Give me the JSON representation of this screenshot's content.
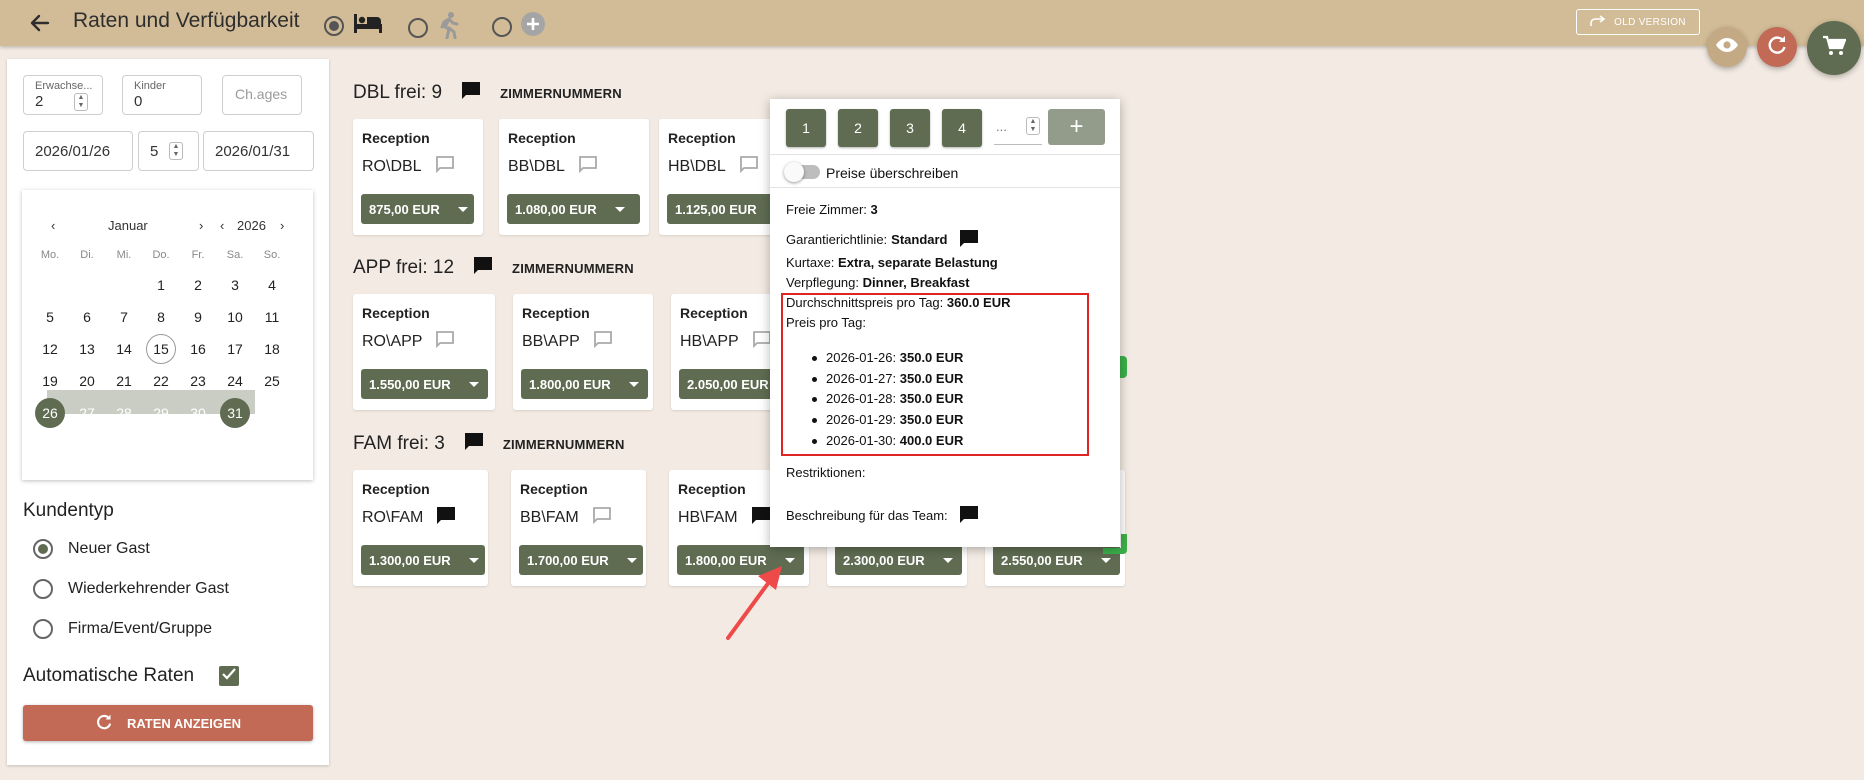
{
  "header": {
    "title": "Raten und Verfügbarkeit",
    "old_version_label": "OLD VERSION"
  },
  "guests": {
    "adults_label": "Erwachse...",
    "adults_value": "2",
    "children_label": "Kinder",
    "children_value": "0",
    "child_ages_placeholder": "Ch.ages"
  },
  "dates": {
    "arrival": "2026/01/26",
    "nights": "5",
    "departure": "2026/01/31"
  },
  "calendar": {
    "month": "Januar",
    "year": "2026",
    "weekdays": [
      "Mo.",
      "Di.",
      "Mi.",
      "Do.",
      "Fr.",
      "Sa.",
      "So."
    ],
    "days": [
      "1",
      "2",
      "3",
      "4",
      "5",
      "6",
      "7",
      "8",
      "9",
      "10",
      "11",
      "12",
      "13",
      "14",
      "15",
      "16",
      "17",
      "18",
      "19",
      "20",
      "21",
      "22",
      "23",
      "24",
      "25",
      "26",
      "27",
      "28",
      "29",
      "30",
      "31"
    ],
    "today": "15",
    "range_start": "26",
    "range_end": "31"
  },
  "customer_type": {
    "title": "Kundentyp",
    "options": [
      "Neuer Gast",
      "Wiederkehrender Gast",
      "Firma/Event/Gruppe"
    ],
    "selected": "Neuer Gast"
  },
  "auto_rates": {
    "label": "Automatische Raten",
    "checked": true
  },
  "show_rates_button": "RATEN ANZEIGEN",
  "room_numbers_label": "ZIMMERNUMMERN",
  "sections": [
    {
      "title": "DBL frei: 9",
      "cards": [
        {
          "label": "Reception",
          "code": "RO\\DBL",
          "price": "875,00 EUR"
        },
        {
          "label": "Reception",
          "code": "BB\\DBL",
          "price": "1.080,00 EUR"
        },
        {
          "label": "Reception",
          "code": "HB\\DBL",
          "price": "1.125,00 EUR"
        }
      ]
    },
    {
      "title": "APP frei: 12",
      "cards": [
        {
          "label": "Reception",
          "code": "RO\\APP",
          "price": "1.550,00 EUR"
        },
        {
          "label": "Reception",
          "code": "BB\\APP",
          "price": "1.800,00 EUR"
        },
        {
          "label": "Reception",
          "code": "HB\\APP",
          "price": "2.050,00 EUR"
        }
      ]
    },
    {
      "title": "FAM frei: 3",
      "cards": [
        {
          "label": "Reception",
          "code": "RO\\FAM",
          "price": "1.300,00 EUR"
        },
        {
          "label": "Reception",
          "code": "BB\\FAM",
          "price": "1.700,00 EUR"
        },
        {
          "label": "Reception",
          "code": "HB\\FAM",
          "price": "1.800,00 EUR"
        },
        {
          "label": "",
          "code": "",
          "price": "2.300,00 EUR"
        },
        {
          "label": "",
          "code": "",
          "price": "2.550,00 EUR"
        }
      ]
    }
  ],
  "popup": {
    "room_buttons": [
      "1",
      "2",
      "3",
      "4"
    ],
    "more_placeholder": "...",
    "override_label": "Preise überschreiben",
    "free_rooms_label": "Freie Zimmer:",
    "free_rooms_value": "3",
    "guarantee_label": "Garantierichtlinie:",
    "guarantee_value": "Standard",
    "tax_label": "Kurtaxe:",
    "tax_value": "Extra, separate Belastung",
    "meals_label": "Verpflegung:",
    "meals_value": "Dinner, Breakfast",
    "avg_label": "Durchschnittspreis pro Tag:",
    "avg_value": "360.0 EUR",
    "per_day_label": "Preis pro Tag:",
    "per_day": [
      {
        "date": "2026-01-26:",
        "price": "350.0 EUR"
      },
      {
        "date": "2026-01-27:",
        "price": "350.0 EUR"
      },
      {
        "date": "2026-01-28:",
        "price": "350.0 EUR"
      },
      {
        "date": "2026-01-29:",
        "price": "350.0 EUR"
      },
      {
        "date": "2026-01-30:",
        "price": "400.0 EUR"
      }
    ],
    "restrictions_label": "Restriktionen:",
    "team_desc_label": "Beschreibung für das Team:"
  },
  "colors": {
    "topbar": "#d2bc97",
    "accent_green": "#5f6c52",
    "accent_red": "#c26a55",
    "highlight": "#e02424"
  },
  "icons": [
    "back-arrow-icon",
    "bed-icon",
    "walking-person-icon",
    "plus-circle-icon",
    "share-arrow-icon",
    "eye-icon",
    "refresh-icon",
    "cart-icon",
    "chat-bubble-icon",
    "chevron-left-icon",
    "chevron-right-icon",
    "check-icon"
  ]
}
